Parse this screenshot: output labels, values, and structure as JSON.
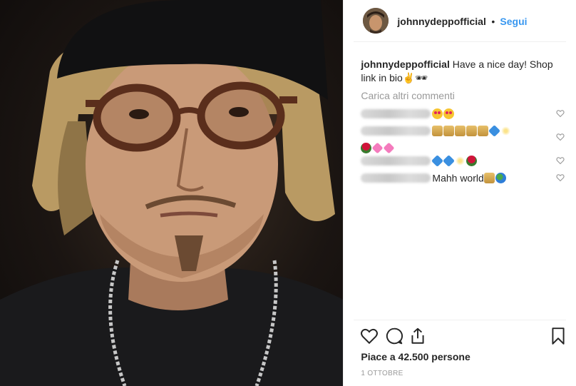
{
  "post": {
    "username": "johnnydeppofficial",
    "dot": "•",
    "follow_label": "Segui",
    "caption_user": "johnnydeppofficial",
    "caption_text": "Have a nice day! Shop link in bio✌️🕶",
    "load_more": "Carica altri commenti",
    "comments": [
      {
        "icons": [
          "heart-eyes-emoji",
          "heart-eyes-emoji"
        ],
        "text": ""
      },
      {
        "icons": [
          "shopping-bag-emoji",
          "shopping-bag-emoji",
          "shopping-bag-emoji",
          "shopping-bag-emoji",
          "shopping-bag-emoji",
          "blue-heart-emoji",
          "dizzy-emoji",
          "rose-emoji",
          "sparkling-heart-emoji",
          "sparkling-heart-emoji"
        ],
        "text": ""
      },
      {
        "icons": [
          "blue-heart-emoji",
          "blue-heart-emoji",
          "dizzy-emoji",
          "rose-emoji"
        ],
        "text": ""
      },
      {
        "icons": [
          "shopping-bag-emoji",
          "earth-emoji"
        ],
        "text": "Mahh world"
      }
    ],
    "likes": "Piace a 42.500 persone",
    "date": "1 OTTOBRE"
  },
  "colors": {
    "link": "#3897f0",
    "text": "#262626",
    "muted": "#999999"
  }
}
